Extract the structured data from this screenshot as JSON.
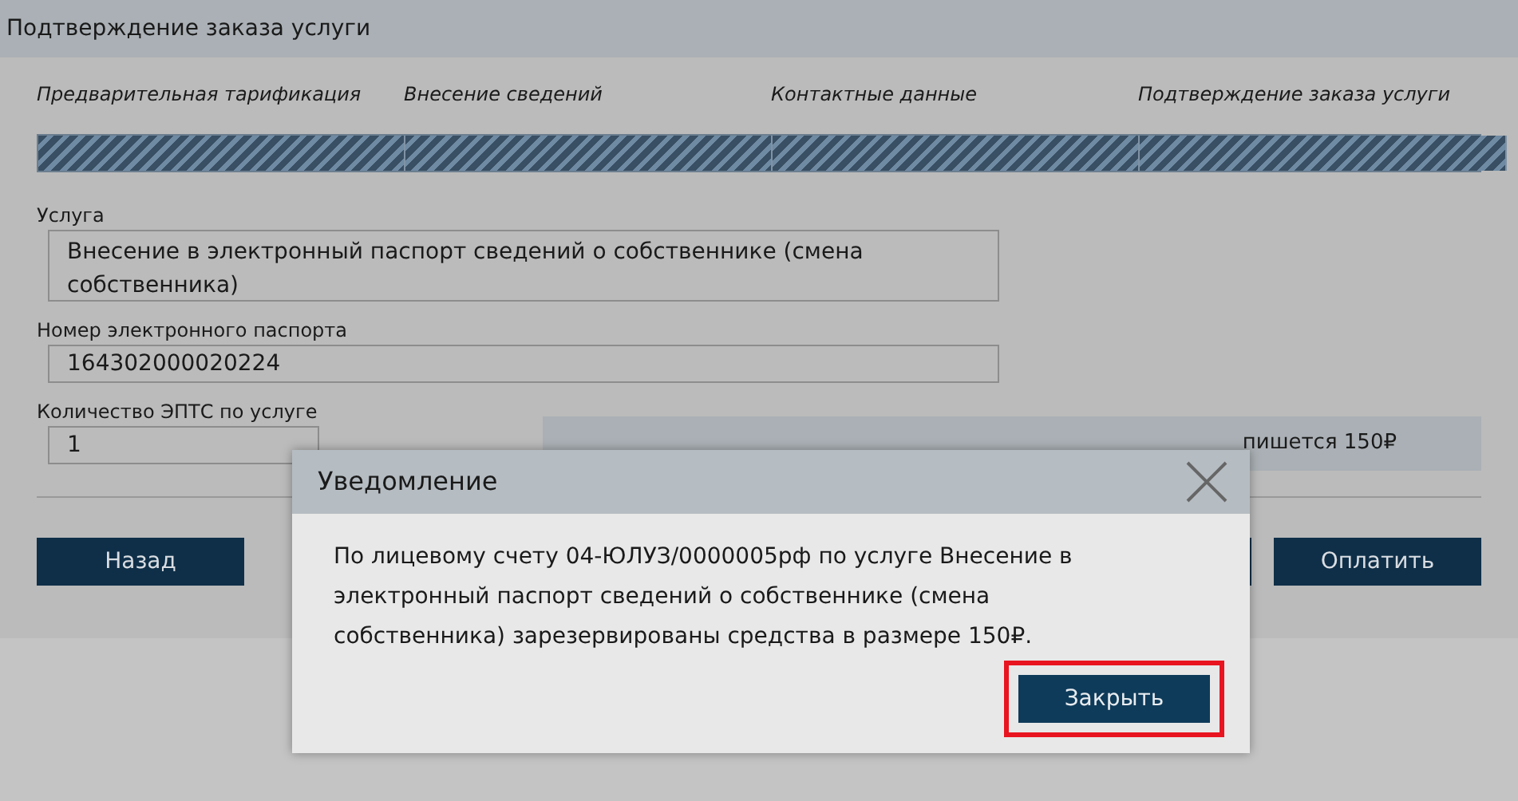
{
  "page": {
    "title": "Подтверждение заказа услуги"
  },
  "steps": [
    {
      "label": "Предварительная тарификация",
      "done": true
    },
    {
      "label": "Внесение сведений",
      "done": true
    },
    {
      "label": "Контактные данные",
      "done": true
    },
    {
      "label": "Подтверждение заказа услуги",
      "done": true
    }
  ],
  "fields": [
    {
      "label": "Услуга",
      "value": "Внесение в электронный паспорт сведений о собственнике (смена собственника)"
    },
    {
      "label": "Номер электронного паспорта",
      "value": "164302000020224"
    },
    {
      "label": "Количество ЭПТС по услуге",
      "value": "1"
    }
  ],
  "charge_note": "пишется 150₽",
  "buttons": {
    "back": "Назад",
    "pay": "Оплатить"
  },
  "dialog": {
    "title": "Уведомление",
    "message": "По лицевому счету 04-ЮЛУЗ/0000005рф по услуге Внесение в электронный паспорт сведений о собственнике (смена собственника) зарезервированы средства в размере 150₽.",
    "close_button": "Закрыть"
  }
}
